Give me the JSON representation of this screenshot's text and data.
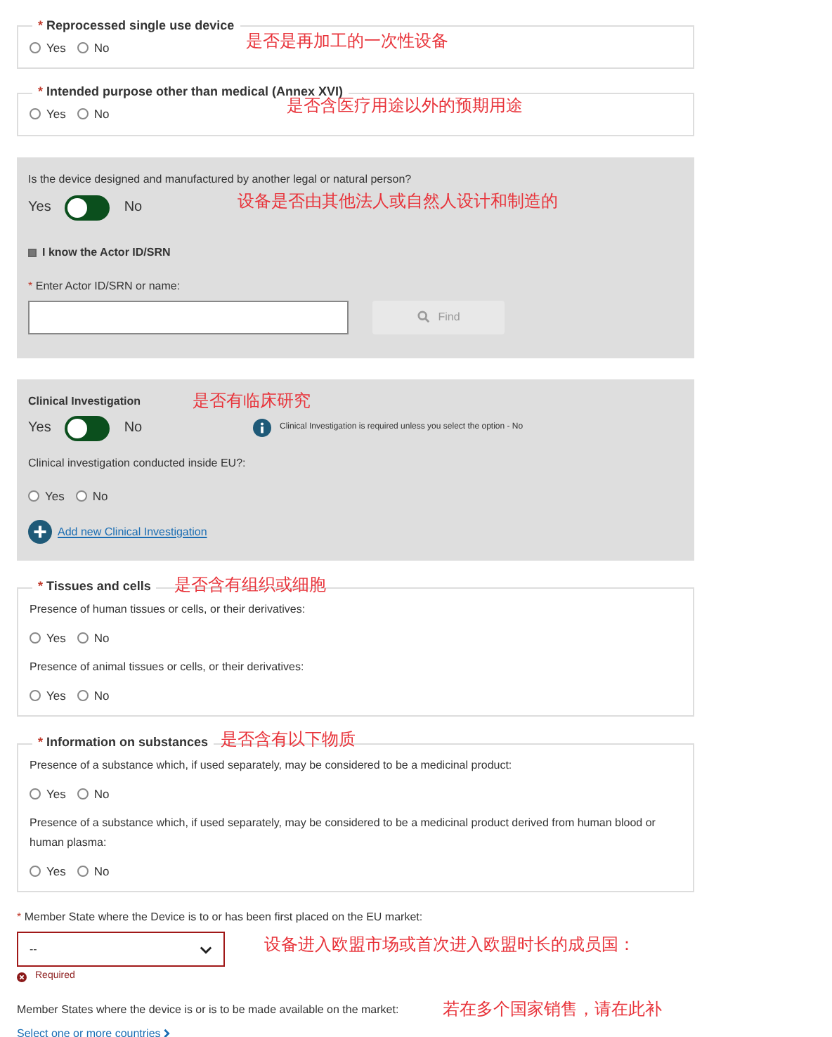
{
  "sections": [
    {
      "kind": "fieldset",
      "title": "Reprocessed single use device",
      "marker": "*",
      "annotation": "是否是再加工的一次性设备",
      "questions": [
        {
          "options": [
            {
              "label": "Yes",
              "selected": false
            },
            {
              "label": "No",
              "selected": false
            }
          ]
        }
      ]
    },
    {
      "kind": "fieldset",
      "title": "Intended purpose other than medical (Annex XVI)",
      "marker": "*",
      "annotation": "是否含医疗用途以外的预期用途",
      "questions": [
        {
          "options": [
            {
              "label": "Yes",
              "selected": false
            },
            {
              "label": "No",
              "selected": false
            }
          ]
        }
      ]
    },
    {
      "kind": "actor_panel",
      "question": "Is the device designed and manufactured by another legal or natural person?",
      "annotation": "设备是否由其他法人或自然人设计和制造的",
      "toggle": {
        "yes": "Yes",
        "no": "No",
        "on": false
      },
      "checkbox": {
        "label": "I know the Actor ID/SRN",
        "checked": true
      },
      "field_label": "Enter Actor ID/SRN or name:",
      "field_marker": "*",
      "find_button": {
        "label": "Find",
        "disabled": true
      }
    },
    {
      "kind": "clinical_panel",
      "title": "Clinical Investigation",
      "annotation": "是否有临床研究",
      "toggle": {
        "yes": "Yes",
        "no": "No",
        "on": false
      },
      "info": "Clinical Investigation is required unless you select the option - No",
      "question": "Clinical investigation conducted inside EU?:",
      "options": [
        {
          "label": "Yes",
          "selected": false
        },
        {
          "label": "No",
          "selected": false
        }
      ],
      "link": "Add new Clinical Investigation"
    },
    {
      "kind": "fieldset",
      "title": "Tissues and cells",
      "marker": "*",
      "annotation": "是否含有组织或细胞",
      "questions": [
        {
          "text": "Presence of human tissues or cells, or their derivatives:",
          "options": [
            {
              "label": "Yes",
              "selected": false
            },
            {
              "label": "No",
              "selected": false
            }
          ]
        },
        {
          "text": "Presence of animal tissues or cells, or their derivatives:",
          "options": [
            {
              "label": "Yes",
              "selected": false
            },
            {
              "label": "No",
              "selected": false
            }
          ]
        }
      ]
    },
    {
      "kind": "fieldset",
      "title": "Information on substances",
      "marker": "*",
      "annotation": "是否含有以下物质",
      "questions": [
        {
          "text": "Presence of a substance which, if used separately, may be considered to be a medicinal product:",
          "options": [
            {
              "label": "Yes",
              "selected": false
            },
            {
              "label": "No",
              "selected": false
            }
          ]
        },
        {
          "text": "Presence of a substance which, if used separately, may be considered to be a medicinal product derived from human blood or human plasma:",
          "options": [
            {
              "label": "Yes",
              "selected": false
            },
            {
              "label": "No",
              "selected": false
            }
          ]
        }
      ]
    },
    {
      "kind": "member_state",
      "label": "Member State where the Device is to or has been first placed on the EU market:",
      "marker": "*",
      "value": "--",
      "error": "Required",
      "annotation": "设备进入欧盟市场或首次进入欧盟时长的成员国："
    },
    {
      "kind": "markets",
      "label": "Member States where the device is or is to be made available on the market:",
      "annotation": "若在多个国家销售，请在此补",
      "link": "Select one or more countries"
    }
  ]
}
